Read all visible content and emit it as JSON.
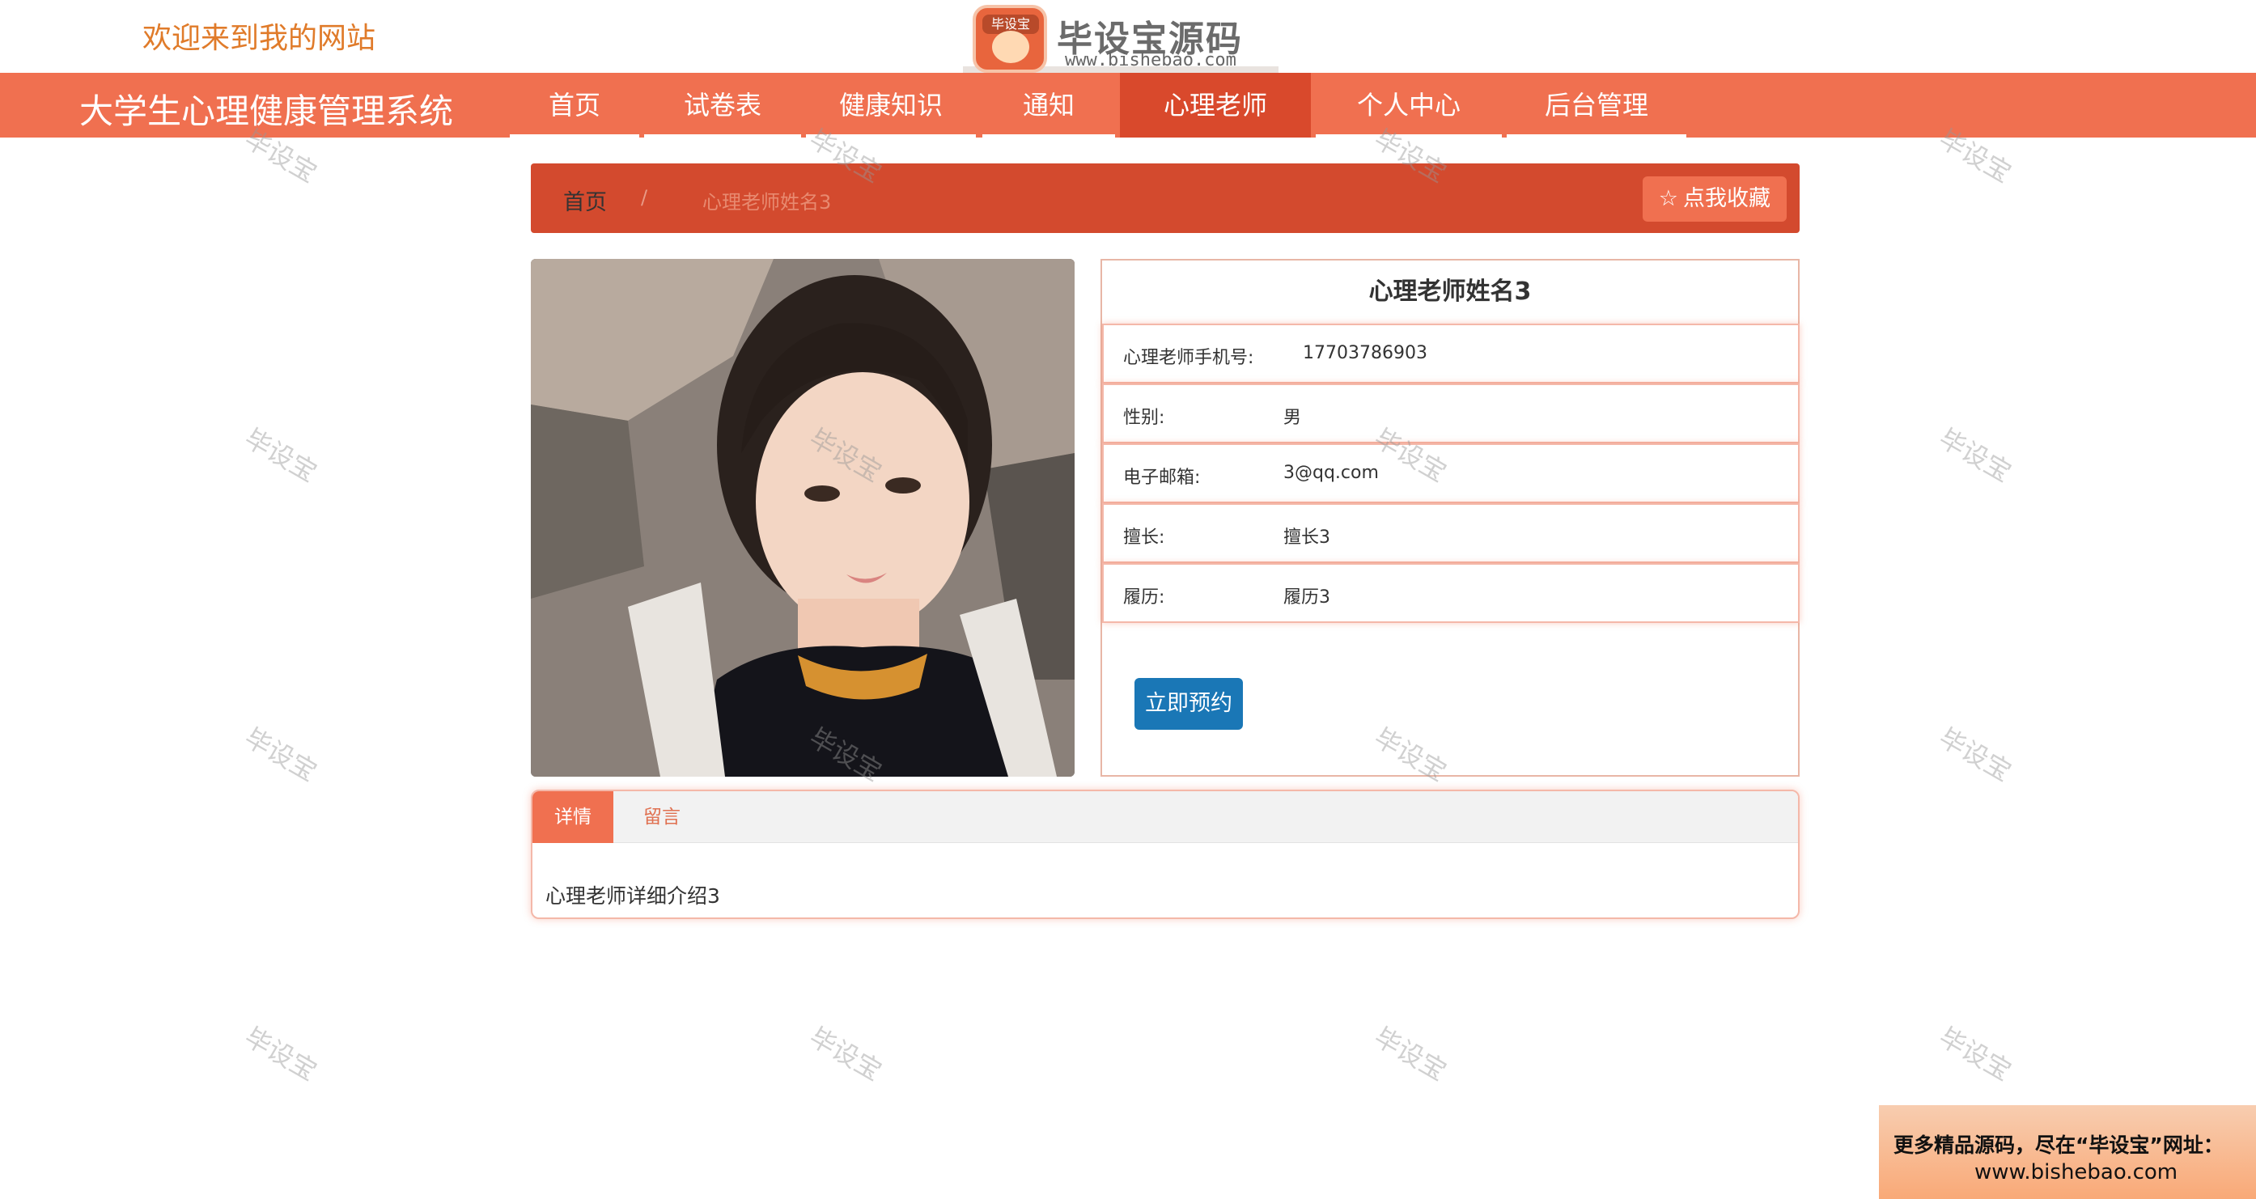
{
  "header": {
    "welcome_text": "欢迎来到我的网站",
    "logo": {
      "badge_text": "毕设宝",
      "title": "毕设宝源码网",
      "url": "www.bishebao.com"
    }
  },
  "navbar": {
    "site_title": "大学生心理健康管理系统",
    "items": [
      {
        "label": "首页"
      },
      {
        "label": "试卷表"
      },
      {
        "label": "健康知识"
      },
      {
        "label": "通知"
      },
      {
        "label": "心理老师",
        "active": true
      },
      {
        "label": "个人中心"
      },
      {
        "label": "后台管理"
      }
    ]
  },
  "breadcrumb": {
    "home": "首页",
    "separator": "/",
    "current": "心理老师姓名3",
    "favorite_icon": "star-outline-icon",
    "favorite_label": "点我收藏"
  },
  "teacher": {
    "name": "心理老师姓名3",
    "photo_alt": "teacher-photo",
    "fields": [
      {
        "label": "心理老师手机号:",
        "value": "17703786903"
      },
      {
        "label": "性别:",
        "value": "男"
      },
      {
        "label": "电子邮箱:",
        "value": "3@qq.com"
      },
      {
        "label": "擅长:",
        "value": "擅长3"
      },
      {
        "label": "履历:",
        "value": "履历3"
      }
    ],
    "book_button": "立即预约"
  },
  "tabs": {
    "items": [
      {
        "label": "详情",
        "active": true
      },
      {
        "label": "留言"
      }
    ],
    "content": "心理老师详细介绍3"
  },
  "watermark_text": "毕设宝",
  "promo": {
    "line1": "更多精品源码，尽在“毕设宝”网址：",
    "line2": "www.bishebao.com"
  },
  "colors": {
    "nav_bg": "#f07050",
    "nav_active": "#d9492c",
    "breadcrumb_bg": "#d34a2e",
    "book_button": "#1a77b6",
    "welcome_text": "#e07b2a"
  }
}
